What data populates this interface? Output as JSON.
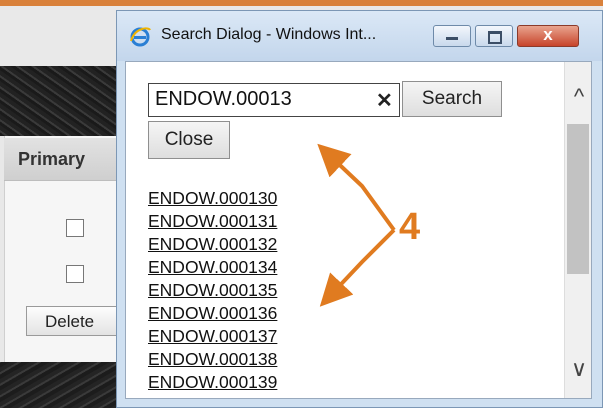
{
  "background": {
    "panel_heading": "Primary",
    "delete_button_label": "Delete"
  },
  "dialog": {
    "title": "Search Dialog - Windows Int...",
    "search_input_value": "ENDOW.00013",
    "clear_glyph": "✕",
    "search_button_label": "Search",
    "close_button_label": "Close",
    "results": [
      "ENDOW.000130",
      "ENDOW.000131",
      "ENDOW.000132",
      "ENDOW.000134",
      "ENDOW.000135",
      "ENDOW.000136",
      "ENDOW.000137",
      "ENDOW.000138",
      "ENDOW.000139"
    ],
    "scroll_up_glyph": "^",
    "scroll_down_glyph": "∨",
    "window_close_glyph": "x"
  },
  "annotation": {
    "label": "4",
    "color": "#e07b20"
  },
  "colors": {
    "titlebar": "#c3d6ec",
    "close_button": "#c7442b",
    "accent_orange": "#e07b20"
  }
}
